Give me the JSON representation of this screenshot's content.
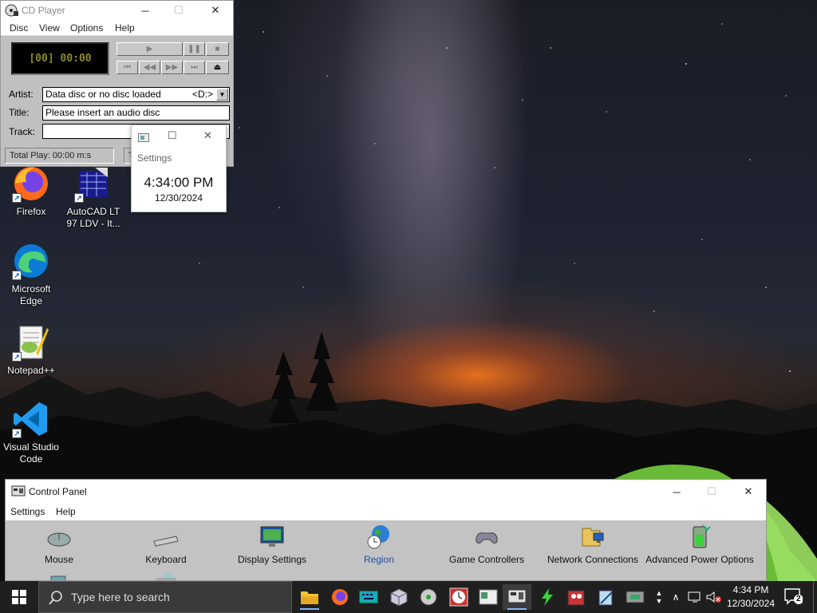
{
  "cd_player": {
    "title": "CD Player",
    "menu": [
      "Disc",
      "View",
      "Options",
      "Help"
    ],
    "display": "[00] 00:00",
    "artist_label": "Artist:",
    "artist_value": "Data disc or no disc loaded",
    "drive": "<D:>",
    "title_label": "Title:",
    "title_value": "Please insert an audio disc",
    "track_label": "Track:",
    "track_value": "",
    "status": "Total Play: 00:00 m:s",
    "status2": "T"
  },
  "settings_popup": {
    "title": "Settings",
    "time": "4:34:00 PM",
    "date": "12/30/2024"
  },
  "desktop_icons": [
    {
      "label": "Firefox",
      "icon": "firefox-icon"
    },
    {
      "label": "AutoCAD LT 97 LDV - It...",
      "icon": "autocad-icon"
    },
    {
      "label": "Microsoft Edge",
      "icon": "edge-icon"
    },
    {
      "label": "Notepad++",
      "icon": "notepadpp-icon"
    },
    {
      "label": "Visual Studio Code",
      "icon": "vscode-icon"
    }
  ],
  "control_panel": {
    "title": "Control Panel",
    "menu": [
      "Settings",
      "Help"
    ],
    "items": [
      {
        "label": "Mouse",
        "icon": "mouse-icon"
      },
      {
        "label": "Keyboard",
        "icon": "keyboard-icon"
      },
      {
        "label": "Display Settings",
        "icon": "display-icon"
      },
      {
        "label": "Region",
        "icon": "globe-clock-icon",
        "selected": true
      },
      {
        "label": "Game Controllers",
        "icon": "gamepad-icon"
      },
      {
        "label": "Network Connections",
        "icon": "network-icon"
      },
      {
        "label": "Advanced Power Options",
        "icon": "power-icon"
      }
    ]
  },
  "taskbar": {
    "search_placeholder": "Type here to search",
    "clock_time": "4:34 PM",
    "clock_date": "12/30/2024",
    "notification_count": "2",
    "accent": "#8ab4f8"
  }
}
